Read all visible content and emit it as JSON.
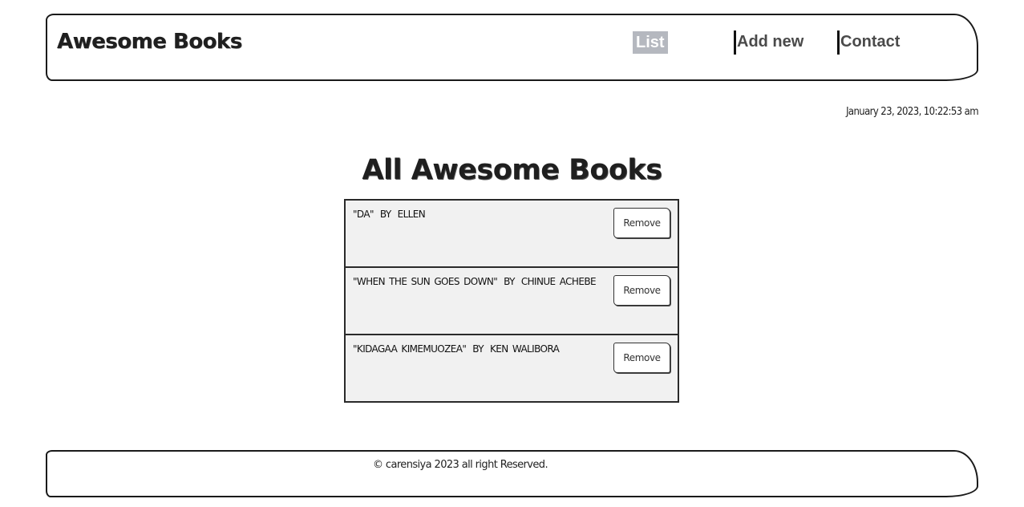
{
  "header": {
    "logo": "Awesome Books",
    "nav": {
      "list": "List",
      "add_new": "Add new",
      "contact": "Contact"
    }
  },
  "datetime": "January 23, 2023, 10:22:53 am",
  "main": {
    "title": "All Awesome Books",
    "books": [
      {
        "title": "\"DA\"",
        "by": "BY",
        "author": "ELLEN",
        "remove_label": "Remove"
      },
      {
        "title": "\"WHEN THE SUN GOES DOWN\"",
        "by": "BY",
        "author": "CHINUE ACHEBE",
        "remove_label": "Remove"
      },
      {
        "title": "\"KIDAGAA KIMEMUOZEA\"",
        "by": "BY",
        "author": "KEN WALIBORA",
        "remove_label": "Remove"
      }
    ]
  },
  "footer": {
    "copyright": "© carensiya 2023 all right Reserved."
  },
  "colors": {
    "active_nav_bg": "#b5b8bf",
    "book_row_bg": "#f1f1f1",
    "border": "#1a1a1a"
  }
}
